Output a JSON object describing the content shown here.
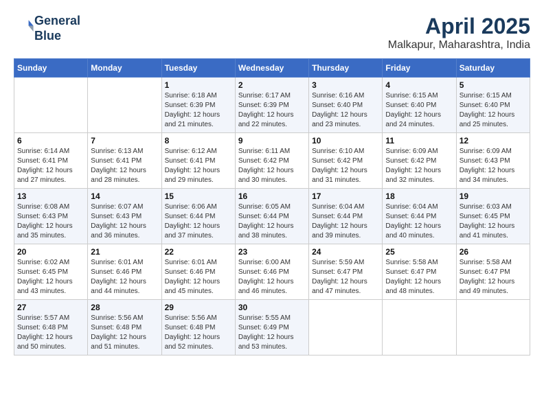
{
  "header": {
    "logo_line1": "General",
    "logo_line2": "Blue",
    "title": "April 2025",
    "subtitle": "Malkapur, Maharashtra, India"
  },
  "days_of_week": [
    "Sunday",
    "Monday",
    "Tuesday",
    "Wednesday",
    "Thursday",
    "Friday",
    "Saturday"
  ],
  "weeks": [
    [
      {
        "day": "",
        "sunrise": "",
        "sunset": "",
        "daylight": ""
      },
      {
        "day": "",
        "sunrise": "",
        "sunset": "",
        "daylight": ""
      },
      {
        "day": "1",
        "sunrise": "Sunrise: 6:18 AM",
        "sunset": "Sunset: 6:39 PM",
        "daylight": "Daylight: 12 hours and 21 minutes."
      },
      {
        "day": "2",
        "sunrise": "Sunrise: 6:17 AM",
        "sunset": "Sunset: 6:39 PM",
        "daylight": "Daylight: 12 hours and 22 minutes."
      },
      {
        "day": "3",
        "sunrise": "Sunrise: 6:16 AM",
        "sunset": "Sunset: 6:40 PM",
        "daylight": "Daylight: 12 hours and 23 minutes."
      },
      {
        "day": "4",
        "sunrise": "Sunrise: 6:15 AM",
        "sunset": "Sunset: 6:40 PM",
        "daylight": "Daylight: 12 hours and 24 minutes."
      },
      {
        "day": "5",
        "sunrise": "Sunrise: 6:15 AM",
        "sunset": "Sunset: 6:40 PM",
        "daylight": "Daylight: 12 hours and 25 minutes."
      }
    ],
    [
      {
        "day": "6",
        "sunrise": "Sunrise: 6:14 AM",
        "sunset": "Sunset: 6:41 PM",
        "daylight": "Daylight: 12 hours and 27 minutes."
      },
      {
        "day": "7",
        "sunrise": "Sunrise: 6:13 AM",
        "sunset": "Sunset: 6:41 PM",
        "daylight": "Daylight: 12 hours and 28 minutes."
      },
      {
        "day": "8",
        "sunrise": "Sunrise: 6:12 AM",
        "sunset": "Sunset: 6:41 PM",
        "daylight": "Daylight: 12 hours and 29 minutes."
      },
      {
        "day": "9",
        "sunrise": "Sunrise: 6:11 AM",
        "sunset": "Sunset: 6:42 PM",
        "daylight": "Daylight: 12 hours and 30 minutes."
      },
      {
        "day": "10",
        "sunrise": "Sunrise: 6:10 AM",
        "sunset": "Sunset: 6:42 PM",
        "daylight": "Daylight: 12 hours and 31 minutes."
      },
      {
        "day": "11",
        "sunrise": "Sunrise: 6:09 AM",
        "sunset": "Sunset: 6:42 PM",
        "daylight": "Daylight: 12 hours and 32 minutes."
      },
      {
        "day": "12",
        "sunrise": "Sunrise: 6:09 AM",
        "sunset": "Sunset: 6:43 PM",
        "daylight": "Daylight: 12 hours and 34 minutes."
      }
    ],
    [
      {
        "day": "13",
        "sunrise": "Sunrise: 6:08 AM",
        "sunset": "Sunset: 6:43 PM",
        "daylight": "Daylight: 12 hours and 35 minutes."
      },
      {
        "day": "14",
        "sunrise": "Sunrise: 6:07 AM",
        "sunset": "Sunset: 6:43 PM",
        "daylight": "Daylight: 12 hours and 36 minutes."
      },
      {
        "day": "15",
        "sunrise": "Sunrise: 6:06 AM",
        "sunset": "Sunset: 6:44 PM",
        "daylight": "Daylight: 12 hours and 37 minutes."
      },
      {
        "day": "16",
        "sunrise": "Sunrise: 6:05 AM",
        "sunset": "Sunset: 6:44 PM",
        "daylight": "Daylight: 12 hours and 38 minutes."
      },
      {
        "day": "17",
        "sunrise": "Sunrise: 6:04 AM",
        "sunset": "Sunset: 6:44 PM",
        "daylight": "Daylight: 12 hours and 39 minutes."
      },
      {
        "day": "18",
        "sunrise": "Sunrise: 6:04 AM",
        "sunset": "Sunset: 6:44 PM",
        "daylight": "Daylight: 12 hours and 40 minutes."
      },
      {
        "day": "19",
        "sunrise": "Sunrise: 6:03 AM",
        "sunset": "Sunset: 6:45 PM",
        "daylight": "Daylight: 12 hours and 41 minutes."
      }
    ],
    [
      {
        "day": "20",
        "sunrise": "Sunrise: 6:02 AM",
        "sunset": "Sunset: 6:45 PM",
        "daylight": "Daylight: 12 hours and 43 minutes."
      },
      {
        "day": "21",
        "sunrise": "Sunrise: 6:01 AM",
        "sunset": "Sunset: 6:46 PM",
        "daylight": "Daylight: 12 hours and 44 minutes."
      },
      {
        "day": "22",
        "sunrise": "Sunrise: 6:01 AM",
        "sunset": "Sunset: 6:46 PM",
        "daylight": "Daylight: 12 hours and 45 minutes."
      },
      {
        "day": "23",
        "sunrise": "Sunrise: 6:00 AM",
        "sunset": "Sunset: 6:46 PM",
        "daylight": "Daylight: 12 hours and 46 minutes."
      },
      {
        "day": "24",
        "sunrise": "Sunrise: 5:59 AM",
        "sunset": "Sunset: 6:47 PM",
        "daylight": "Daylight: 12 hours and 47 minutes."
      },
      {
        "day": "25",
        "sunrise": "Sunrise: 5:58 AM",
        "sunset": "Sunset: 6:47 PM",
        "daylight": "Daylight: 12 hours and 48 minutes."
      },
      {
        "day": "26",
        "sunrise": "Sunrise: 5:58 AM",
        "sunset": "Sunset: 6:47 PM",
        "daylight": "Daylight: 12 hours and 49 minutes."
      }
    ],
    [
      {
        "day": "27",
        "sunrise": "Sunrise: 5:57 AM",
        "sunset": "Sunset: 6:48 PM",
        "daylight": "Daylight: 12 hours and 50 minutes."
      },
      {
        "day": "28",
        "sunrise": "Sunrise: 5:56 AM",
        "sunset": "Sunset: 6:48 PM",
        "daylight": "Daylight: 12 hours and 51 minutes."
      },
      {
        "day": "29",
        "sunrise": "Sunrise: 5:56 AM",
        "sunset": "Sunset: 6:48 PM",
        "daylight": "Daylight: 12 hours and 52 minutes."
      },
      {
        "day": "30",
        "sunrise": "Sunrise: 5:55 AM",
        "sunset": "Sunset: 6:49 PM",
        "daylight": "Daylight: 12 hours and 53 minutes."
      },
      {
        "day": "",
        "sunrise": "",
        "sunset": "",
        "daylight": ""
      },
      {
        "day": "",
        "sunrise": "",
        "sunset": "",
        "daylight": ""
      },
      {
        "day": "",
        "sunrise": "",
        "sunset": "",
        "daylight": ""
      }
    ]
  ]
}
